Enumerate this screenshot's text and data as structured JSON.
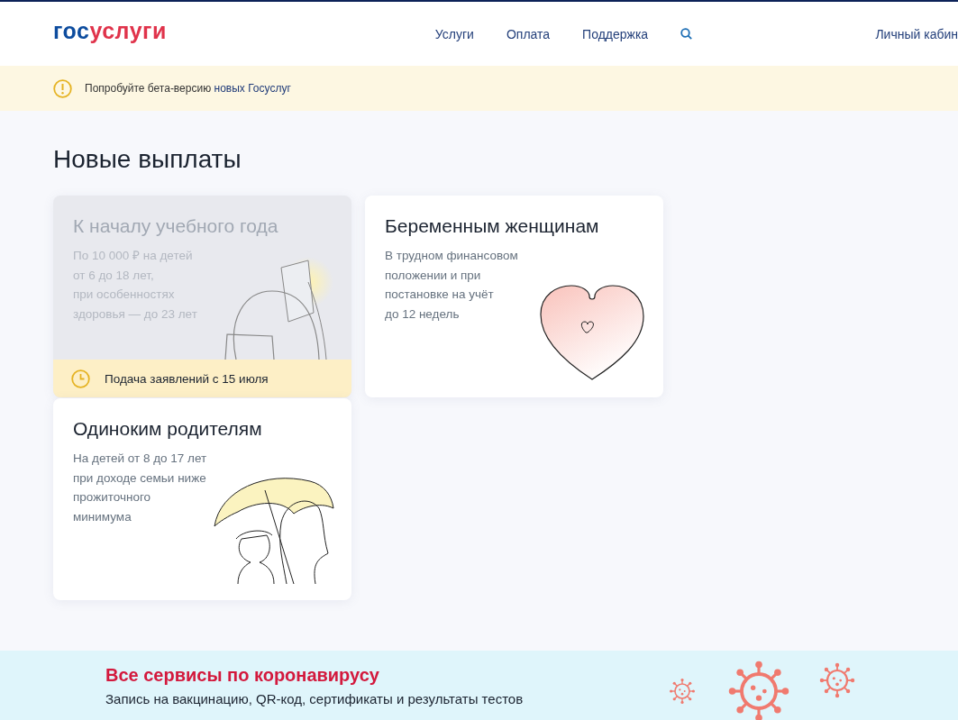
{
  "header": {
    "logo": {
      "part_1": "гос",
      "part_2": "услуги"
    },
    "nav": [
      {
        "label": "Услуги"
      },
      {
        "label": "Оплата"
      },
      {
        "label": "Поддержка"
      }
    ],
    "profile_link": "Личный кабин"
  },
  "beta_banner": {
    "text": "Попробуйте бета-версию",
    "link": "новых Госуслуг"
  },
  "section_title": "Новые выплаты",
  "cards": [
    {
      "kind": "backpack",
      "disabled": true,
      "title": "К началу учебного года",
      "description": "По 10 000 ₽ на детей\nот 6 до 18 лет,\nпри особенностях\nздоровья — до 23 лет",
      "deadline": "Подача заявлений с 15 июля"
    },
    {
      "kind": "heart",
      "disabled": false,
      "title": "Беременным женщинам",
      "description": "В трудном финансовом\nположении и при\nпостановке на учёт\nдо 12 недель"
    },
    {
      "kind": "umbrella",
      "disabled": false,
      "title": "Одиноким родителям",
      "description": "На детей от 8 до 17 лет\nпри доходе семьи ниже\nпрожиточного\nминимума"
    }
  ],
  "covid_banner": {
    "title": "Все сервисы по коронавирусу",
    "subtitle": "Запись на вакцинацию, QR-код, сертификаты и результаты тестов"
  }
}
